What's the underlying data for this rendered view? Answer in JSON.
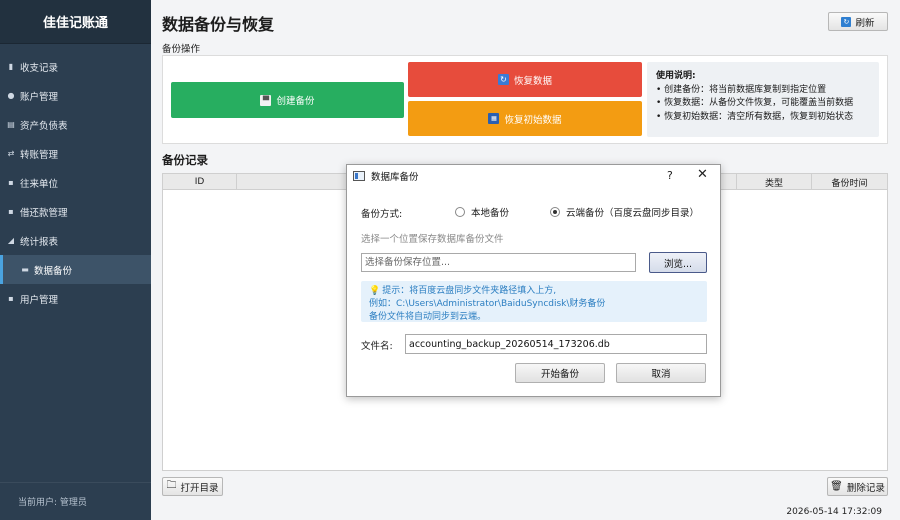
{
  "app": {
    "name": "佳佳记账通"
  },
  "sidebar": {
    "items": [
      {
        "label": "收支记录",
        "icon": "chart-icon"
      },
      {
        "label": "账户管理",
        "icon": "wallet-icon"
      },
      {
        "label": "资产负债表",
        "icon": "ledger-icon"
      },
      {
        "label": "转账管理",
        "icon": "transfer-icon"
      },
      {
        "label": "往来单位",
        "icon": "contacts-icon"
      },
      {
        "label": "借还款管理",
        "icon": "loan-icon"
      },
      {
        "label": "统计报表",
        "icon": "report-icon"
      },
      {
        "label": "数据备份",
        "icon": "backup-icon"
      },
      {
        "label": "用户管理",
        "icon": "user-icon"
      }
    ],
    "current_user": "当前用户: 管理员"
  },
  "main": {
    "title": "数据备份与恢复",
    "refresh_label": "刷新",
    "ops_section_label": "备份操作",
    "buttons": {
      "create": "创建备份",
      "restore": "恢复数据",
      "restore_init": "恢复初始数据"
    },
    "usage": {
      "heading": "使用说明:",
      "lines": [
        "• 创建备份：将当前数据库复制到指定位置",
        "• 恢复数据：从备份文件恢复，可能覆盖当前数据",
        "• 恢复初始数据：清空所有数据，恢复到初始状态"
      ]
    },
    "records_title": "备份记录",
    "table": {
      "headers": [
        "ID",
        "",
        "类型",
        "备份时间"
      ]
    },
    "open_dir_label": "打开目录",
    "delete_label": "删除记录",
    "status_time": "2026-05-14 17:32:09"
  },
  "dialog": {
    "title": "数据库备份",
    "help": "?",
    "close": "✕",
    "method_label": "备份方式:",
    "local_option": "本地备份",
    "cloud_option": "云端备份（百度云盘同步目录）",
    "selected_option": "cloud",
    "hint": "选择一个位置保存数据库备份文件",
    "path_placeholder": "选择备份保存位置...",
    "browse_label": "浏览...",
    "info": {
      "line1": "提示：将百度云盘同步文件夹路径填入上方,",
      "line2": "例如：C:\\Users\\Administrator\\BaiduSyncdisk\\财务备份",
      "line3": "备份文件将自动同步到云端。"
    },
    "filename_label": "文件名:",
    "filename_value": "accounting_backup_20260514_173206.db",
    "start_label": "开始备份",
    "cancel_label": "取消"
  },
  "colors": {
    "sidebar_bg": "#2c3e50",
    "create_btn": "#27ae60",
    "restore_btn": "#e74c3c",
    "restore_init_btn": "#f39c12",
    "info_text": "#2b7ec1"
  }
}
